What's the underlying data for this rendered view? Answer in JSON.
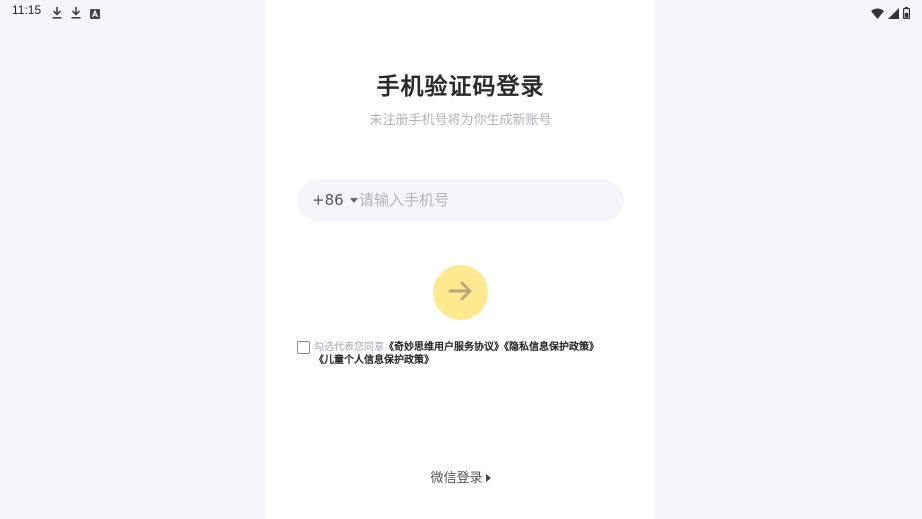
{
  "status_bar": {
    "time": "11:15",
    "left_icons": [
      "download-icon",
      "download-icon",
      "app-notification-icon"
    ],
    "right_icons": [
      "wifi-icon",
      "cellular-signal-icon",
      "battery-icon"
    ]
  },
  "login": {
    "title": "手机验证码登录",
    "subtitle": "未注册手机号将为你生成新账号",
    "country_code": "+86",
    "phone_placeholder": "请输入手机号",
    "phone_value": "",
    "submit_icon": "arrow-right-icon",
    "agreement": {
      "checked": false,
      "prefix": "勾选代表您同意",
      "links": [
        "《奇妙思维用户服务协议》",
        "《隐私信息保护政策》",
        "《儿童个人信息保护政策》"
      ]
    },
    "wechat_login_label": "微信登录"
  },
  "colors": {
    "background": "#f5f6fa",
    "panel": "#ffffff",
    "accent_button": "#ffe98f",
    "input_background": "#f5f6fa",
    "muted_text": "#b0b3ba"
  }
}
